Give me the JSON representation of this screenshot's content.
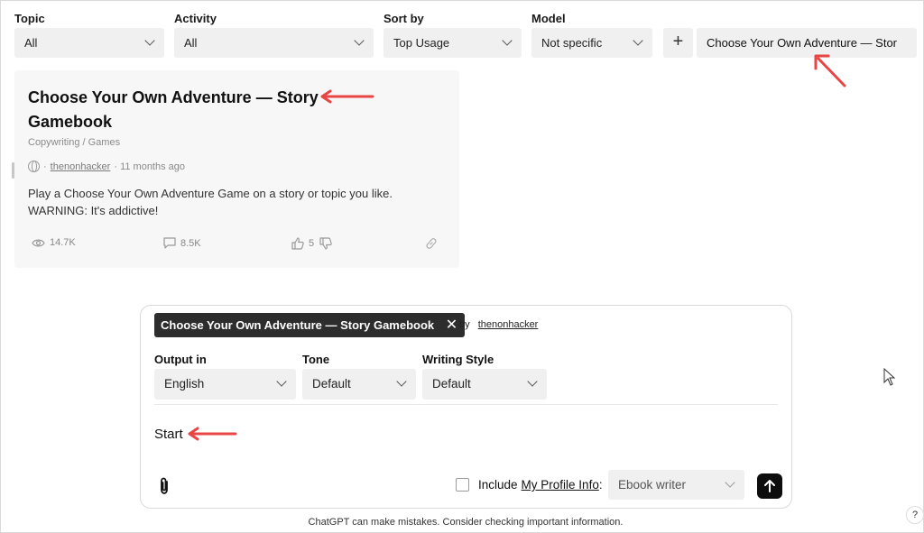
{
  "filters": {
    "topic": {
      "label": "Topic",
      "value": "All"
    },
    "activity": {
      "label": "Activity",
      "value": "All"
    },
    "sort": {
      "label": "Sort by",
      "value": "Top Usage"
    },
    "model": {
      "label": "Model",
      "value": "Not specific"
    },
    "add_label": "+",
    "search_value": "Choose Your Own Adventure — Stor"
  },
  "card": {
    "title": "Choose Your Own Adventure — Story Gamebook",
    "category": "Copywriting / Games",
    "meta_prefix": "·",
    "author": "thenonhacker",
    "meta_time": "· 11 months ago",
    "description": "Play a Choose Your Own Adventure Game on a story or topic you like. WARNING: It's addictive!",
    "views": "14.7K",
    "comments": "8.5K",
    "votes": "5"
  },
  "composer": {
    "chip_label": "Choose Your Own Adventure — Story Gamebook",
    "chip_close": "✕",
    "by_label": "by",
    "author": "thenonhacker",
    "output": {
      "label": "Output in",
      "value": "English"
    },
    "tone": {
      "label": "Tone",
      "value": "Default"
    },
    "style": {
      "label": "Writing Style",
      "value": "Default"
    },
    "prompt_text": "Start",
    "include_prefix": "Include",
    "include_link": "My Profile Info",
    "include_suffix": ":",
    "writer_value": "Ebook writer"
  },
  "footer": {
    "disclaimer": "ChatGPT can make mistakes. Consider checking important information.",
    "help_label": "?"
  },
  "colors": {
    "annotation_arrow": "#e84545",
    "chip_bg": "#2d2d2d",
    "select_bg": "#f0f0f0"
  },
  "icons": [
    "chevron-down-icon",
    "globe-icon",
    "eye-icon",
    "comment-icon",
    "thumbs-up-icon",
    "thumbs-down-icon",
    "link-icon",
    "paperclip-icon",
    "arrow-up-icon",
    "close-icon",
    "mouse-cursor-icon"
  ]
}
